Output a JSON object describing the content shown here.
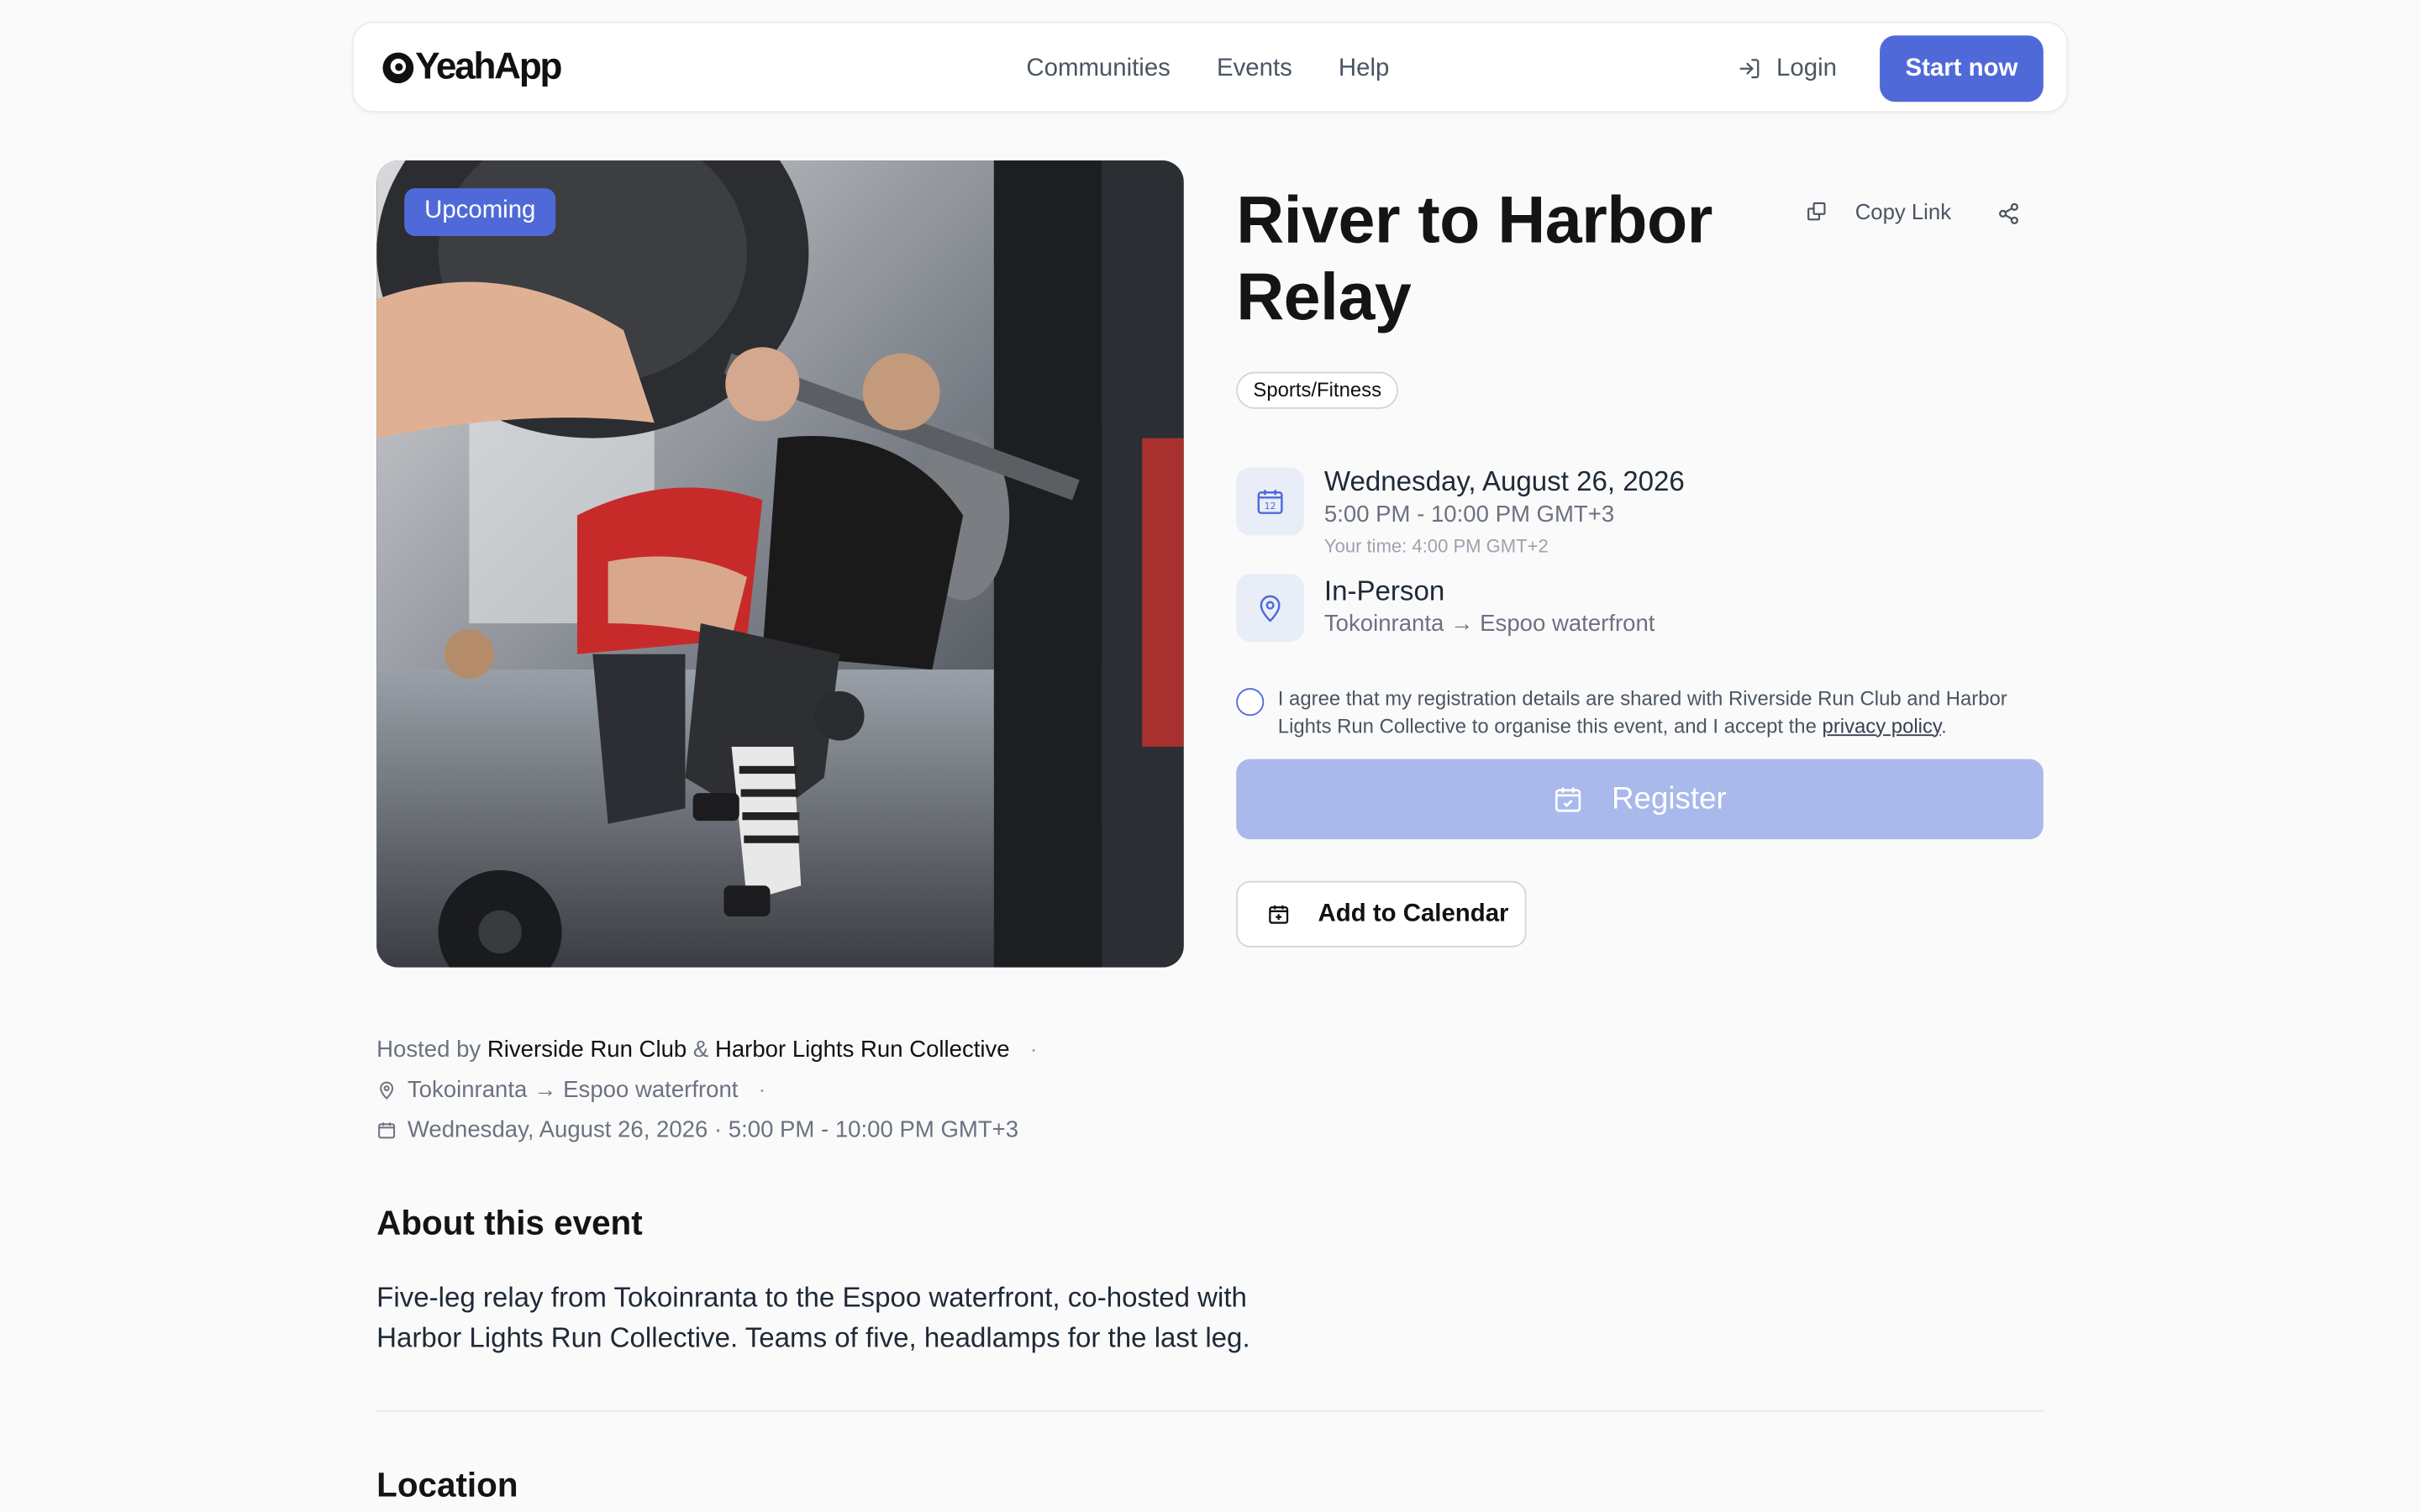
{
  "nav": {
    "brand": "YeahApp",
    "links": [
      "Communities",
      "Events",
      "Help"
    ],
    "login_label": "Login",
    "start_label": "Start now"
  },
  "event": {
    "status_badge": "Upcoming",
    "title": "River to Harbor Relay",
    "copy_link_label": "Copy Link",
    "category": "Sports/Fitness",
    "date": "Wednesday, August 26, 2026",
    "time": "5:00 PM - 10:00 PM GMT+3",
    "your_time": "Your time: 4:00 PM GMT+2",
    "format": "In-Person",
    "location": "Tokoinranta → Espoo waterfront",
    "consent_text": "I agree that my registration details are shared with Riverside Run Club and Harbor Lights Run Collective to organise this event, and I accept the",
    "privacy_link": "privacy policy",
    "register_label": "Register",
    "add_calendar_label": "Add to Calendar"
  },
  "meta": {
    "hosted_by_prefix": "Hosted by",
    "host_1": "Riverside Run Club",
    "amp": "&",
    "host_2": "Harbor Lights Run Collective",
    "location": "Tokoinranta → Espoo waterfront",
    "datetime": "Wednesday, August 26, 2026 · 5:00 PM - 10:00 PM GMT+3"
  },
  "about": {
    "heading": "About this event",
    "body": "Five-leg relay from Tokoinranta to the Espoo waterfront, co-hosted with Harbor Lights Run Collective. Teams of five, headlamps for the last leg."
  },
  "location_section": {
    "heading": "Location"
  },
  "colors": {
    "accent": "#4f6ad8",
    "register_disabled": "#a9b9ec",
    "icon_bg": "#e9edf8"
  }
}
